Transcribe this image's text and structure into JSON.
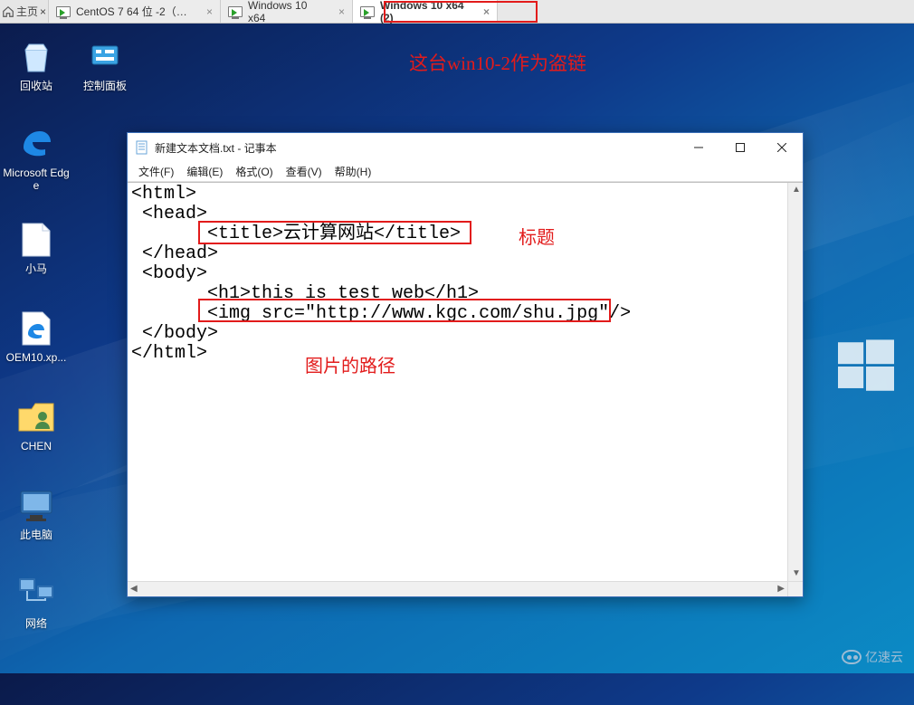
{
  "vm_bar": {
    "home": "主页",
    "tabs": [
      {
        "label": "CentOS 7 64 位 -2（架构专...",
        "active": false
      },
      {
        "label": "Windows 10 x64",
        "active": false
      },
      {
        "label": "Windows 10 x64 (2)",
        "active": true
      }
    ]
  },
  "annotations": {
    "top": "这台win10-2作为盗链",
    "title_label": "标题",
    "img_label": "图片的路径"
  },
  "desktop_icons": {
    "recycle": "回收站",
    "control_panel": "控制面板",
    "edge1": "Microsoft Edge",
    "xiaoma": "小马",
    "oem": "OEM10.xp...",
    "chen": "CHEN",
    "this_pc": "此电脑",
    "network": "网络"
  },
  "notepad": {
    "title": "新建文本文档.txt - 记事本",
    "menu": {
      "file": "文件(F)",
      "edit": "编辑(E)",
      "format": "格式(O)",
      "view": "查看(V)",
      "help": "帮助(H)"
    },
    "content": "<html>\n <head>\n       <title>云计算网站</title>\n </head>\n <body>\n       <h1>this is test web</h1>\n       <img src=\"http://www.kgc.com/shu.jpg\"/>\n </body>\n</html>"
  },
  "watermark": "亿速云"
}
